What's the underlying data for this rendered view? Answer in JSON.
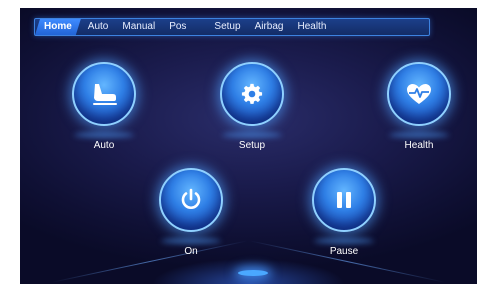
{
  "nav": {
    "tabs": [
      {
        "label": "Home",
        "active": true
      },
      {
        "label": "Auto",
        "active": false
      },
      {
        "label": "Manual",
        "active": false
      },
      {
        "label": "Pos",
        "active": false
      },
      {
        "label": "Setup",
        "active": false
      },
      {
        "label": "Airbag",
        "active": false
      },
      {
        "label": "Health",
        "active": false
      }
    ]
  },
  "buttons": {
    "auto": {
      "label": "Auto",
      "icon": "seat-icon"
    },
    "setup": {
      "label": "Setup",
      "icon": "gear-icon"
    },
    "health": {
      "label": "Health",
      "icon": "heart-pulse-icon"
    },
    "on": {
      "label": "On",
      "icon": "power-icon"
    },
    "pause": {
      "label": "Pause",
      "icon": "pause-icon"
    }
  },
  "colors": {
    "background": "#151642",
    "accent": "#3f8bff",
    "button_glow": "#8fd0ff",
    "text": "#ffffff"
  }
}
